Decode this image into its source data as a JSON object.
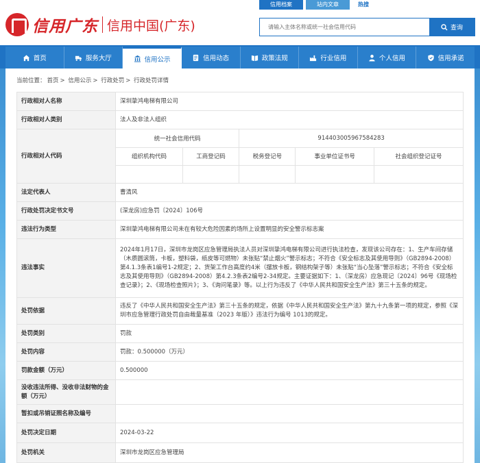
{
  "header": {
    "logo_calligraphy": "信用广东",
    "site_name": "信用中国(广东)",
    "top_links": [
      "信用档案",
      "站内文章"
    ],
    "hot_label": "热搜",
    "search_placeholder": "请输入主体名称或统一社会信用代码",
    "search_button": "查询"
  },
  "nav": {
    "items": [
      {
        "label": "首页",
        "icon": "home-icon"
      },
      {
        "label": "服务大厅",
        "icon": "truck-icon"
      },
      {
        "label": "信用公示",
        "icon": "building-icon"
      },
      {
        "label": "信用动态",
        "icon": "document-icon"
      },
      {
        "label": "政策法规",
        "icon": "book-icon"
      },
      {
        "label": "行业信用",
        "icon": "factory-icon"
      },
      {
        "label": "个人信用",
        "icon": "person-icon"
      },
      {
        "label": "信用承诺",
        "icon": "shield-icon"
      }
    ],
    "active_index": 2
  },
  "breadcrumb": {
    "prefix": "当前位置：",
    "items": [
      "首页",
      "信用公示",
      "行政处罚",
      "行政处罚详情"
    ]
  },
  "record": {
    "name_label": "行政相对人名称",
    "name_value": "深圳挚鸿电梯有限公司",
    "type_label": "行政相对人类别",
    "type_value": "法人及非法人组织",
    "code_label": "行政相对人代码",
    "uscc_label": "统一社会信用代码",
    "uscc_value": "91440300596758428З",
    "org_code_label": "组织机构代码",
    "biz_reg_label": "工商登记码",
    "tax_reg_label": "税务登记号",
    "inst_cert_label": "事业单位证书号",
    "social_org_label": "社会组织登记证号",
    "org_code_value": "",
    "biz_reg_value": "",
    "tax_reg_value": "",
    "inst_cert_value": "",
    "social_org_value": "",
    "legal_rep_label": "法定代表人",
    "legal_rep_value": "曹清风",
    "doc_no_label": "行政处罚决定书文号",
    "doc_no_value": "(深龙房)应急罚〔2024〕106号",
    "violation_type_label": "违法行为类型",
    "violation_type_value": "深圳挚鸿电梯有限公司未在有较大危险因素的场所上设置明显的安全警示标志案",
    "facts_label": "违法事实",
    "facts_value": "2024年1月17日，深圳市龙岗区应急管理局执法人员对深圳挚鸿电梯有限公司进行执法检查，发现该公司存在：1、生产车间存储（木质圆滚筒，卡板，塑料袋，纸皮等可燃物）未张贴“禁止烟火”警示标志；不符合《安全标志及其使用导则》（GB2894-2008）第4.1.3条表1编号1-2规定；2、货架工作台高度约4米（摆放卡板，钢结构架子等）未张贴“当心坠落”警示标志；不符合《安全标志及其使用导则》（GB2894-2008）第4.2.3条表2编号2-34规定。主要证据如下：1、（深龙房）应急现记〔2024〕96号《现场检查记录》；2、《现场检查照片》；3、《询问笔录》等。以上行为违反了《中华人民共和国安全生产法》第三十五条的规定。",
    "basis_label": "处罚依据",
    "basis_value": "违反了《中华人民共和国安全生产法》第三十五条的规定，依据《中华人民共和国安全生产法》第九十九条第一项的规定，参照《深圳市应急管理行政处罚自由裁量基准（2023 年版）》违法行为编号 1013的规定。",
    "category_label": "处罚类别",
    "category_value": "罚款",
    "content_label": "处罚内容",
    "content_value": "罚款：0.500000（万元）",
    "fine_label": "罚款金额（万元）",
    "fine_value": "0.500000",
    "confiscation_label": "没收违法所得、没收非法财物的金额（万元）",
    "confiscation_value": "",
    "license_label": "暂扣或吊销证照名称及编号",
    "license_value": "",
    "date_label": "处罚决定日期",
    "date_value": "2024-03-22",
    "authority_label": "处罚机关",
    "authority_value": "深圳市龙岗区应急管理局"
  },
  "colors": {
    "brand_red": "#d6262a",
    "brand_blue": "#1f73c4"
  }
}
